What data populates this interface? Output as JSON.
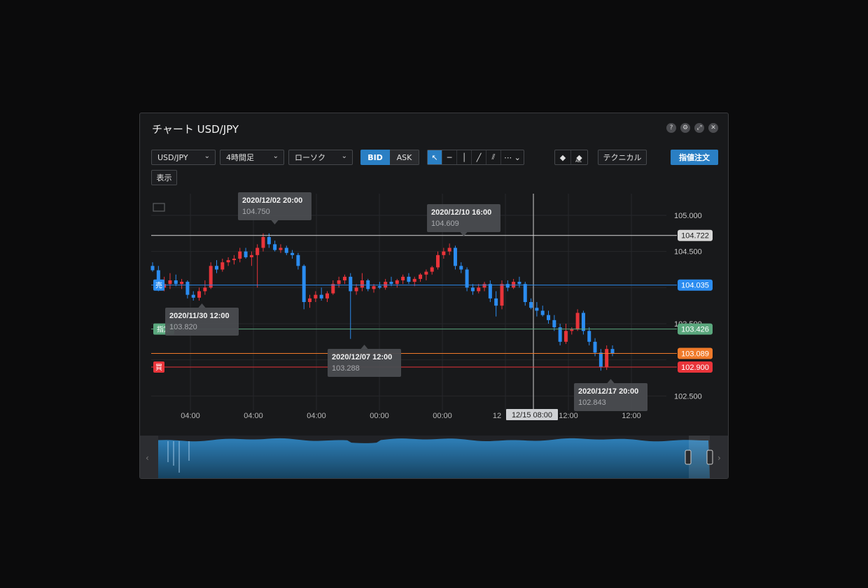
{
  "window": {
    "title": "チャート USD/JPY",
    "title_icons": [
      "help-icon",
      "gear-icon",
      "expand-icon",
      "close-icon"
    ],
    "help_glyph": "?",
    "gear_glyph": "⚙",
    "expand_glyph": "⤢",
    "close_glyph": "✕"
  },
  "toolbar": {
    "symbol": "USD/JPY",
    "timeframe": "4時間足",
    "chart_style": "ローソク",
    "bid_label": "BID",
    "ask_label": "ASK",
    "tools": [
      "cursor",
      "horizontal-line",
      "vertical-line",
      "trend-line",
      "parallel-lines",
      "more"
    ],
    "tool_glyphs": [
      "↖",
      "─",
      "│",
      "╱",
      "⫽",
      "⋯ ⌄"
    ],
    "eraser_all_label": "ALL",
    "technical_label": "テクニカル",
    "order_label": "指値注文",
    "show_label": "表示"
  },
  "colors": {
    "up": "#e8343a",
    "down": "#2b8cf0",
    "sell": "#2b8cf0",
    "buy": "#e8343a",
    "limit": "#5aa77d",
    "order": "#f07a2a"
  },
  "chart_data": {
    "type": "candlestick",
    "symbol": "USD/JPY",
    "ylim": [
      102.3,
      105.3
    ],
    "y_ticks": [
      "105.000",
      "104.500",
      "103.500",
      "102.500"
    ],
    "x_ticks": [
      "04:00",
      "04:00",
      "04:00",
      "00:00",
      "00:00",
      "12",
      "12:00",
      "12:00"
    ],
    "crosshair_label": "12/15 08:00",
    "price_lines": [
      {
        "label": "104.722",
        "value": 104.722,
        "kind": "white",
        "tag": ""
      },
      {
        "label": "104.035",
        "value": 104.035,
        "kind": "sell",
        "tag": "売"
      },
      {
        "label": "103.426",
        "value": 103.426,
        "kind": "limit",
        "tag": "指定"
      },
      {
        "label": "103.089",
        "value": 103.089,
        "kind": "order",
        "tag": ""
      },
      {
        "label": "102.900",
        "value": 102.9,
        "kind": "buy",
        "tag": "買"
      }
    ],
    "annotations": [
      {
        "date": "2020/12/02 20:00",
        "value": "104.750",
        "type": "high"
      },
      {
        "date": "2020/12/10 16:00",
        "value": "104.609",
        "type": "high"
      },
      {
        "date": "2020/11/30 12:00",
        "value": "103.820",
        "type": "low"
      },
      {
        "date": "2020/12/07 12:00",
        "value": "103.288",
        "type": "low"
      },
      {
        "date": "2020/12/17 20:00",
        "value": "102.843",
        "type": "low"
      }
    ],
    "ohlc": [
      [
        104.3,
        104.35,
        104.22,
        104.24
      ],
      [
        104.24,
        104.3,
        103.95,
        104.0
      ],
      [
        104.0,
        104.15,
        103.95,
        104.05
      ],
      [
        104.05,
        104.2,
        103.98,
        104.1
      ],
      [
        104.1,
        104.18,
        104.02,
        104.05
      ],
      [
        104.05,
        104.12,
        103.98,
        104.08
      ],
      [
        104.08,
        104.1,
        103.85,
        103.9
      ],
      [
        103.9,
        103.95,
        103.82,
        103.86
      ],
      [
        103.86,
        104.0,
        103.82,
        103.95
      ],
      [
        103.95,
        104.1,
        103.9,
        104.0
      ],
      [
        104.0,
        104.35,
        103.98,
        104.3
      ],
      [
        104.3,
        104.38,
        104.2,
        104.25
      ],
      [
        104.25,
        104.4,
        104.22,
        104.35
      ],
      [
        104.35,
        104.42,
        104.3,
        104.38
      ],
      [
        104.38,
        104.45,
        104.32,
        104.4
      ],
      [
        104.4,
        104.55,
        104.35,
        104.5
      ],
      [
        104.5,
        104.55,
        104.4,
        104.42
      ],
      [
        104.42,
        104.5,
        104.3,
        104.45
      ],
      [
        104.45,
        104.6,
        104.0,
        104.55
      ],
      [
        104.55,
        104.75,
        104.5,
        104.7
      ],
      [
        104.7,
        104.75,
        104.55,
        104.6
      ],
      [
        104.6,
        104.65,
        104.5,
        104.52
      ],
      [
        104.52,
        104.6,
        104.48,
        104.55
      ],
      [
        104.55,
        104.58,
        104.45,
        104.48
      ],
      [
        104.48,
        104.52,
        104.4,
        104.45
      ],
      [
        104.45,
        104.48,
        104.25,
        104.3
      ],
      [
        104.3,
        104.32,
        103.7,
        103.8
      ],
      [
        103.8,
        103.9,
        103.72,
        103.85
      ],
      [
        103.85,
        103.95,
        103.8,
        103.9
      ],
      [
        103.9,
        104.0,
        103.82,
        103.85
      ],
      [
        103.85,
        103.95,
        103.8,
        103.92
      ],
      [
        103.92,
        104.1,
        103.9,
        104.05
      ],
      [
        104.05,
        104.15,
        104.0,
        104.1
      ],
      [
        104.1,
        104.18,
        104.05,
        104.15
      ],
      [
        104.15,
        104.2,
        103.29,
        103.95
      ],
      [
        103.95,
        104.05,
        103.9,
        104.0
      ],
      [
        104.0,
        104.2,
        103.95,
        104.1
      ],
      [
        104.1,
        104.12,
        103.95,
        103.98
      ],
      [
        103.98,
        104.05,
        103.93,
        104.02
      ],
      [
        104.02,
        104.08,
        103.98,
        104.0
      ],
      [
        104.0,
        104.12,
        103.97,
        104.08
      ],
      [
        104.08,
        104.15,
        104.02,
        104.05
      ],
      [
        104.05,
        104.12,
        104.0,
        104.1
      ],
      [
        104.1,
        104.18,
        104.05,
        104.15
      ],
      [
        104.15,
        104.2,
        104.05,
        104.08
      ],
      [
        104.08,
        104.15,
        104.02,
        104.12
      ],
      [
        104.12,
        104.2,
        104.08,
        104.18
      ],
      [
        104.18,
        104.25,
        104.1,
        104.22
      ],
      [
        104.22,
        104.3,
        104.18,
        104.28
      ],
      [
        104.28,
        104.5,
        104.25,
        104.45
      ],
      [
        104.45,
        104.55,
        104.4,
        104.5
      ],
      [
        104.5,
        104.61,
        104.45,
        104.55
      ],
      [
        104.55,
        104.58,
        104.25,
        104.3
      ],
      [
        104.3,
        104.35,
        104.2,
        104.25
      ],
      [
        104.25,
        104.28,
        103.95,
        104.0
      ],
      [
        104.0,
        104.05,
        103.9,
        103.95
      ],
      [
        103.95,
        104.05,
        103.92,
        104.0
      ],
      [
        104.0,
        104.08,
        103.95,
        104.05
      ],
      [
        104.05,
        104.1,
        103.8,
        103.85
      ],
      [
        103.85,
        103.95,
        103.6,
        103.75
      ],
      [
        103.75,
        104.1,
        103.7,
        104.05
      ],
      [
        104.05,
        104.1,
        103.95,
        104.0
      ],
      [
        104.0,
        104.12,
        103.98,
        104.08
      ],
      [
        104.08,
        104.15,
        104.0,
        104.05
      ],
      [
        104.05,
        104.08,
        103.75,
        103.8
      ],
      [
        103.8,
        103.85,
        103.7,
        103.72
      ],
      [
        103.72,
        103.8,
        103.6,
        103.68
      ],
      [
        103.68,
        103.75,
        103.6,
        103.62
      ],
      [
        103.62,
        103.68,
        103.5,
        103.55
      ],
      [
        103.55,
        103.62,
        103.4,
        103.45
      ],
      [
        103.45,
        103.5,
        103.2,
        103.25
      ],
      [
        103.25,
        103.5,
        103.22,
        103.4
      ],
      [
        103.4,
        103.45,
        103.35,
        103.42
      ],
      [
        103.42,
        103.7,
        103.4,
        103.65
      ],
      [
        103.65,
        103.68,
        103.35,
        103.4
      ],
      [
        103.4,
        103.45,
        103.2,
        103.25
      ],
      [
        103.25,
        103.3,
        103.05,
        103.1
      ],
      [
        103.1,
        103.15,
        102.85,
        102.9
      ],
      [
        102.9,
        103.2,
        102.86,
        103.15
      ],
      [
        103.15,
        103.2,
        103.05,
        103.09
      ]
    ]
  }
}
